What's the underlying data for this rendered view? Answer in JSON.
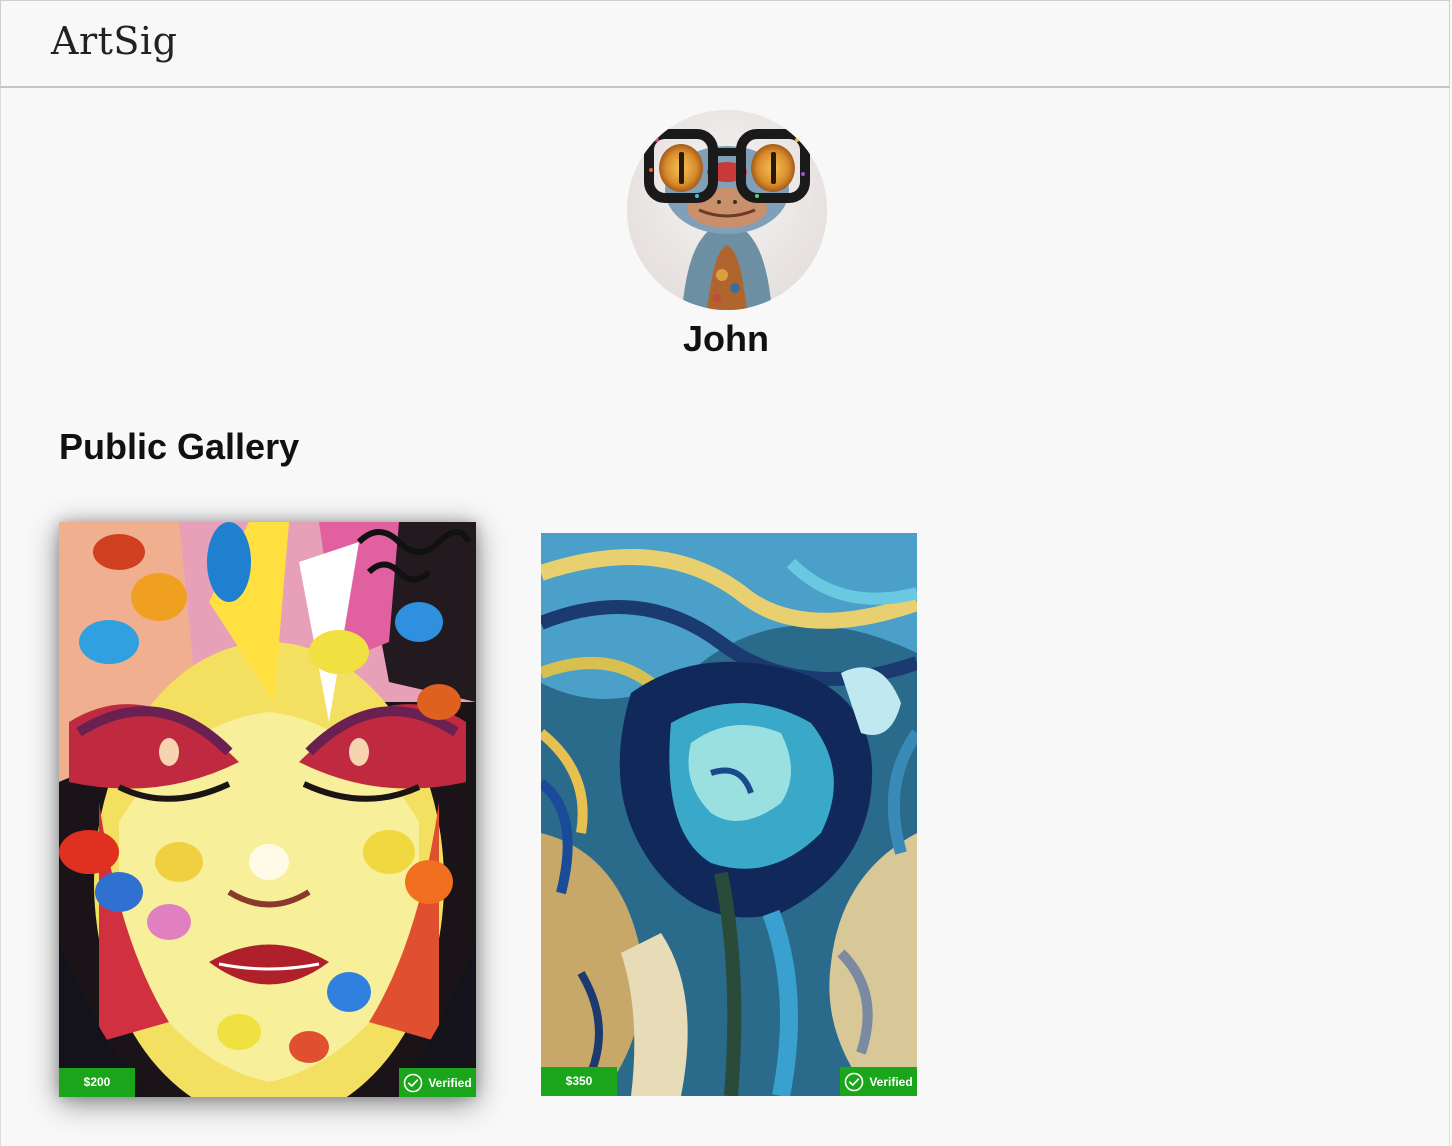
{
  "app": {
    "name": "ArtSig"
  },
  "profile": {
    "username": "John",
    "avatar_icon": "frog-with-glasses-avatar"
  },
  "gallery": {
    "title": "Public Gallery",
    "items": [
      {
        "price": "$200",
        "badge": "Verified",
        "art": "colorful-face-painting",
        "accent": "#1aa51a"
      },
      {
        "price": "$350",
        "badge": "Verified",
        "art": "swirling-abstract-face-painting",
        "accent": "#1aa51a"
      }
    ]
  }
}
